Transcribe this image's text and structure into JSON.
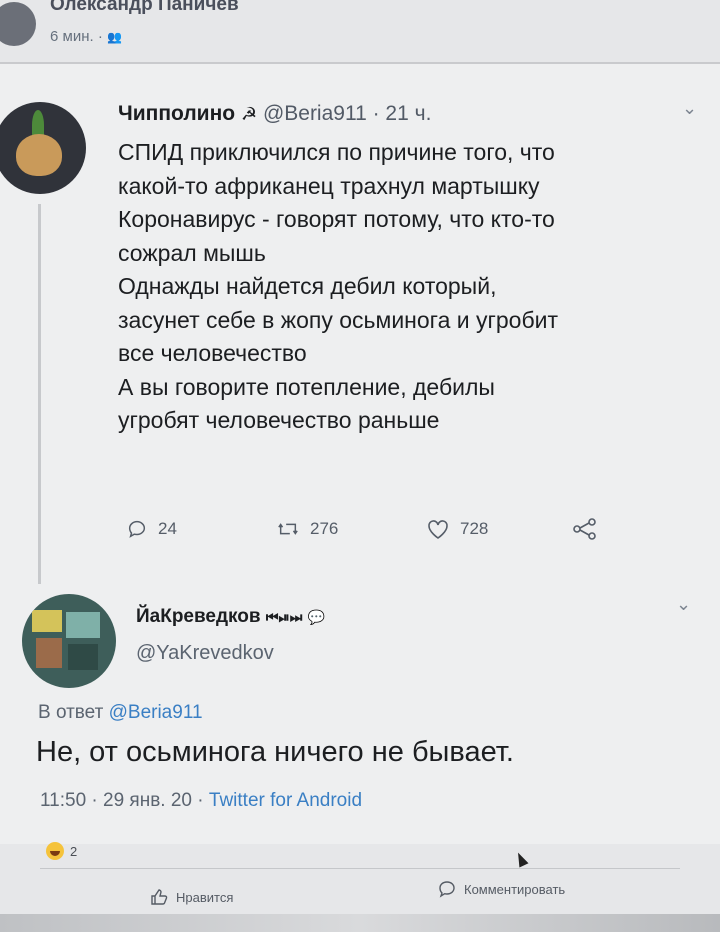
{
  "facebook": {
    "author": "Олександр Паничев",
    "time": "6 мин. ·",
    "reactions_count": "2",
    "like_label": "Нравится",
    "comment_label": "Комментировать"
  },
  "tweet": {
    "display_name": "Чипполино",
    "handle": "@Beria911",
    "time": "· 21 ч.",
    "body_lines": [
      "СПИД приключился  по причине того, что",
      "какой-то африканец трахнул мартышку",
      "Коронавирус - говорят потому, что кто-то",
      "сожрал мышь",
      "Однажды найдется дебил который,",
      "засунет себе в жопу осьминога и угробит",
      "все человечество",
      "А вы говорите потепление, дебилы",
      "угробят человечество раньше"
    ],
    "replies": "24",
    "retweets": "276",
    "likes": "728"
  },
  "reply": {
    "display_name": "ЙаКреведков",
    "handle": "@YaKrevedkov",
    "in_reply_prefix": "В ответ",
    "in_reply_handle": "@Beria911",
    "text": "Не, от осьминога ничего не бывает.",
    "meta_time": "11:50 · 29 янв. 20 ·",
    "meta_source": "Twitter for Android"
  }
}
